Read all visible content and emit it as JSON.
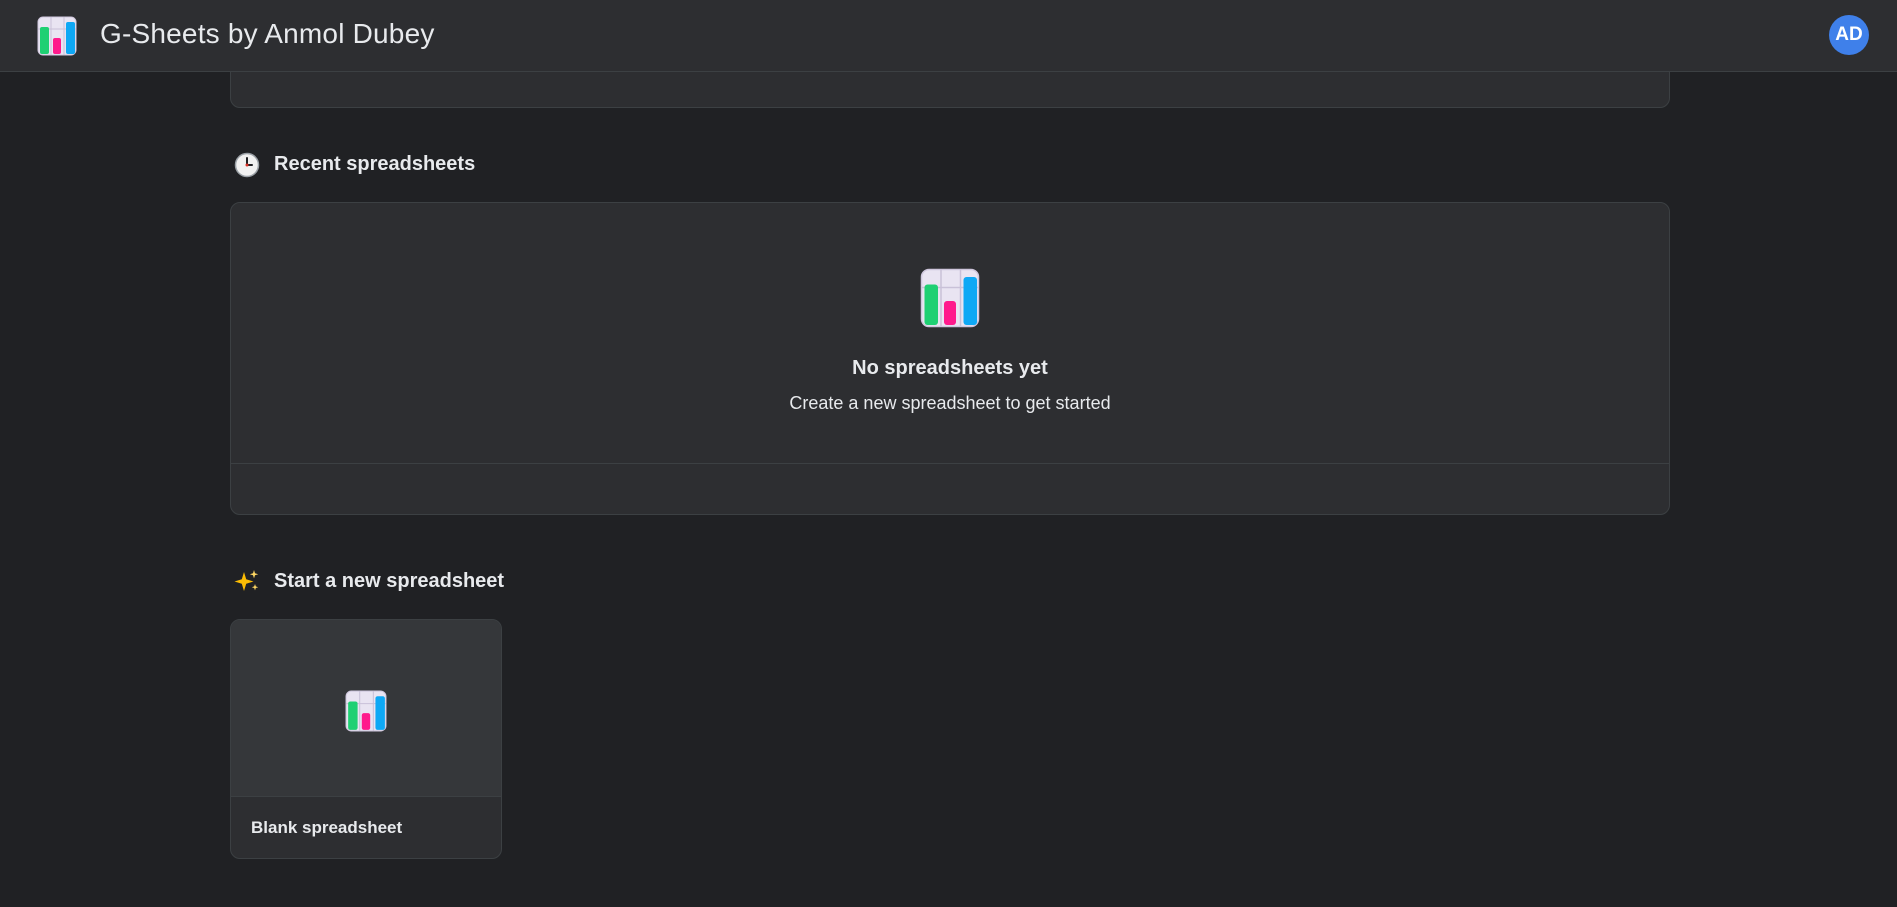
{
  "header": {
    "title": "G-Sheets by Anmol Dubey",
    "logo_icon": "sheets-logo-icon",
    "avatar_initials": "AD"
  },
  "recent": {
    "heading": "Recent spreadsheets",
    "heading_icon": "clock-icon",
    "empty_title": "No spreadsheets yet",
    "empty_subtitle": "Create a new spreadsheet to get started"
  },
  "new_section": {
    "heading": "Start a new spreadsheet",
    "heading_icon": "sparkles-icon",
    "templates": [
      {
        "label": "Blank spreadsheet"
      }
    ]
  },
  "colors": {
    "background": "#202124",
    "surface": "#2d2e31",
    "border": "#3c4043",
    "avatar": "#3f80ea",
    "chart_green": "#1fd073",
    "chart_pink": "#ff1a8c",
    "chart_blue": "#0ea8f5"
  }
}
